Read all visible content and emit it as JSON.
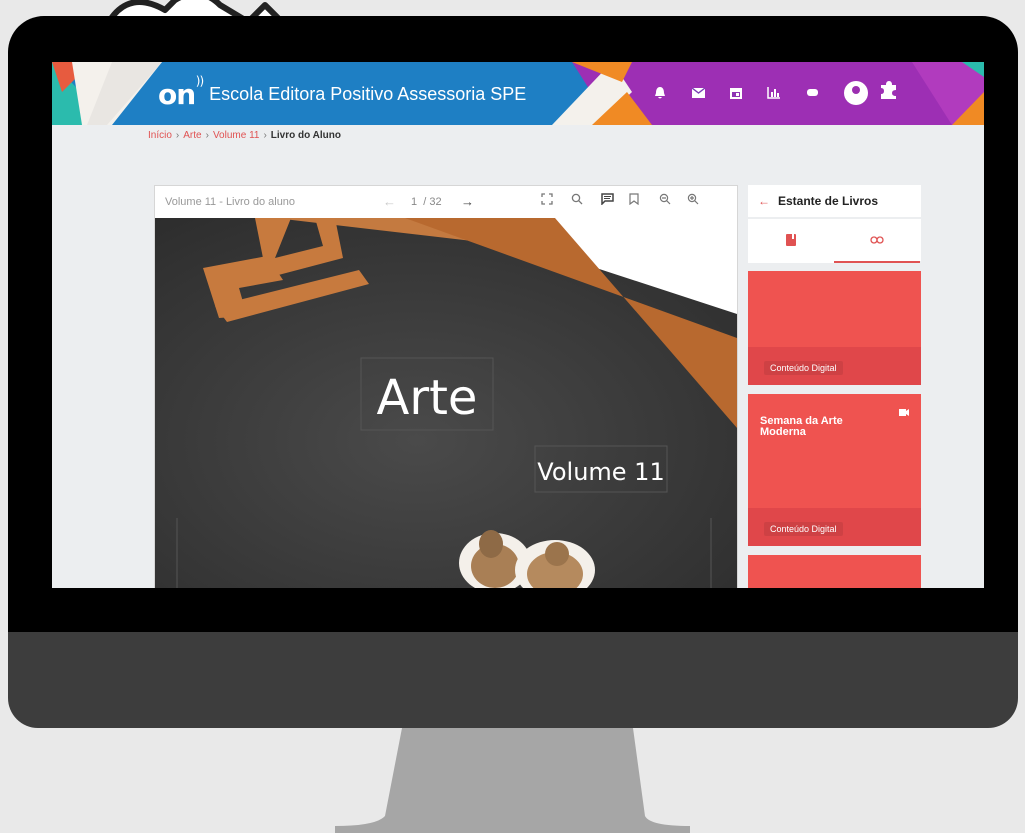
{
  "header": {
    "brand_logo": "on",
    "title": "Escola Editora Positivo Assessoria SPE",
    "icons": [
      "bell-icon",
      "mail-icon",
      "calendar-icon",
      "chart-icon",
      "chat-icon",
      "user-avatar",
      "puzzle-icon"
    ],
    "colors": {
      "blue": "#1e7fc4",
      "purple": "#9d2fb4",
      "orange": "#f08a24",
      "teal": "#2bbbad"
    }
  },
  "breadcrumb": {
    "items": [
      "Início",
      "Arte",
      "Volume 11"
    ],
    "current": "Livro do Aluno"
  },
  "viewer": {
    "doc_title": "Volume 11 - Livro do aluno",
    "page_current": "1",
    "page_total": "/ 32",
    "cover": {
      "title": "Arte",
      "subtitle": "Volume 11"
    }
  },
  "sidebar": {
    "title": "Estante de Livros",
    "tabs": [
      "book-icon",
      "link-icon"
    ],
    "cards": [
      {
        "title": "",
        "label": "Conteúdo Digital"
      },
      {
        "title": "Semana da Arte Moderna",
        "label": "Conteúdo Digital"
      }
    ],
    "accent": "#ef5350"
  }
}
